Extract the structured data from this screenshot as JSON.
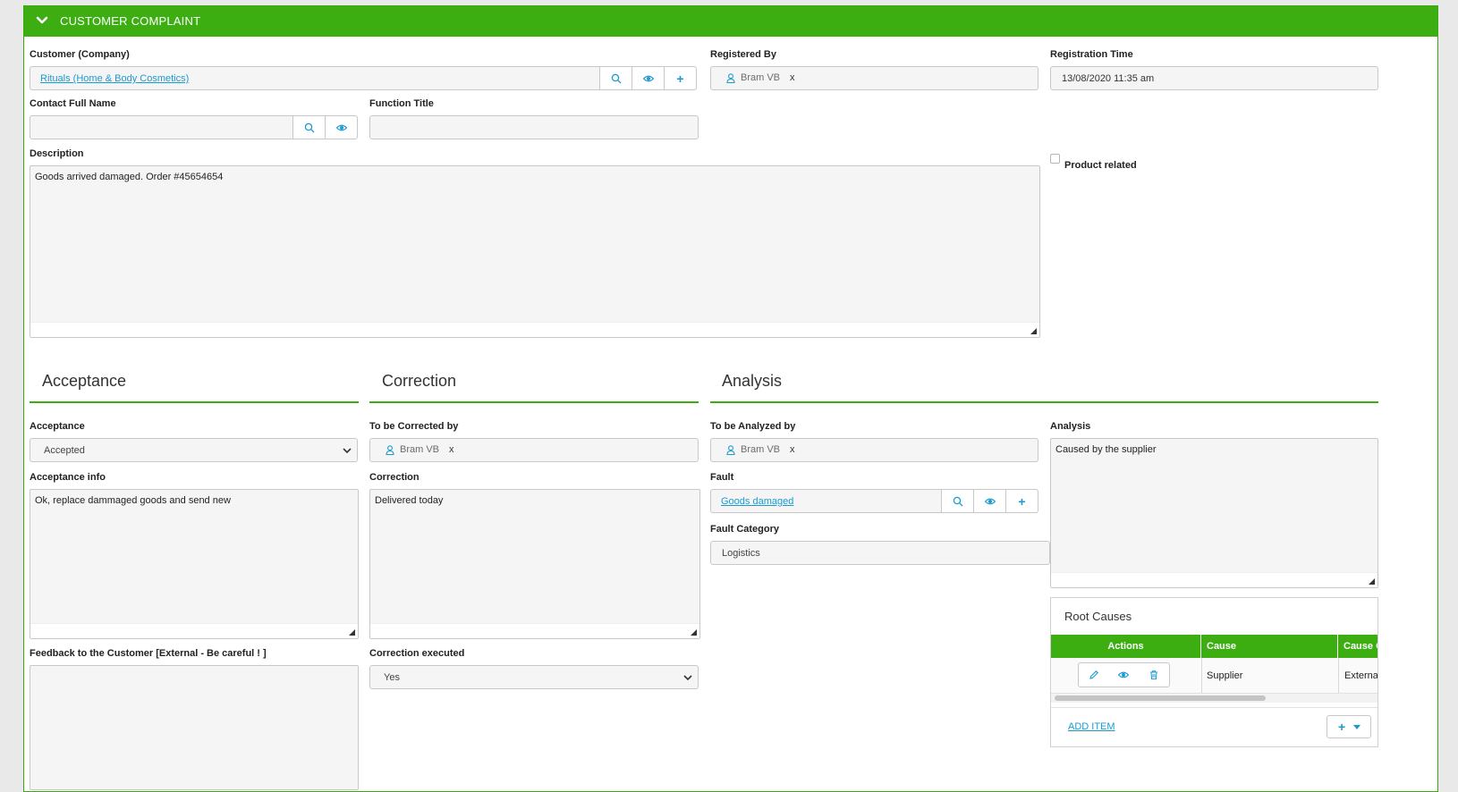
{
  "panel": {
    "title": "CUSTOMER COMPLAINT"
  },
  "customer": {
    "label": "Customer (Company)",
    "value": "Rituals (Home & Body Cosmetics)",
    "add_symbol": "+"
  },
  "registered_by": {
    "label": "Registered By",
    "user": "Bram VB",
    "remove": "x"
  },
  "registration_time": {
    "label": "Registration Time",
    "value": "13/08/2020 11:35 am"
  },
  "contact": {
    "label": "Contact Full Name",
    "value": ""
  },
  "function_title": {
    "label": "Function Title",
    "value": ""
  },
  "description": {
    "label": "Description",
    "value": "Goods arrived damaged. Order #45654654"
  },
  "product_related": {
    "label": "Product related",
    "checked": false
  },
  "sections": {
    "acceptance": "Acceptance",
    "correction": "Correction",
    "analysis": "Analysis"
  },
  "acceptance": {
    "label": "Acceptance",
    "value": "Accepted",
    "info_label": "Acceptance info",
    "info_value": "Ok, replace dammaged goods and send new",
    "feedback_label": "Feedback to the Customer [External - Be careful ! ]",
    "feedback_value": ""
  },
  "correction": {
    "by_label": "To be Corrected by",
    "by_user": "Bram VB",
    "remove": "x",
    "label": "Correction",
    "value": "Delivered today",
    "executed_label": "Correction executed",
    "executed_value": "Yes"
  },
  "analysis": {
    "by_label": "To be Analyzed by",
    "by_user": "Bram VB",
    "remove": "x",
    "fault_label": "Fault",
    "fault_value": "Goods damaged",
    "add_symbol": "+",
    "fault_category_label": "Fault Category",
    "fault_category_value": "Logistics",
    "analysis_label": "Analysis",
    "analysis_value": "Caused by the supplier"
  },
  "root_causes": {
    "title": "Root Causes",
    "columns": [
      "Actions",
      "Cause",
      "Cause Cat"
    ],
    "rows": [
      {
        "cause": "Supplier",
        "category": "External"
      }
    ],
    "add_item": "ADD ITEM",
    "add_symbol": "+"
  },
  "colors": {
    "accent": "#3cae12",
    "link": "#1a9bd0"
  }
}
